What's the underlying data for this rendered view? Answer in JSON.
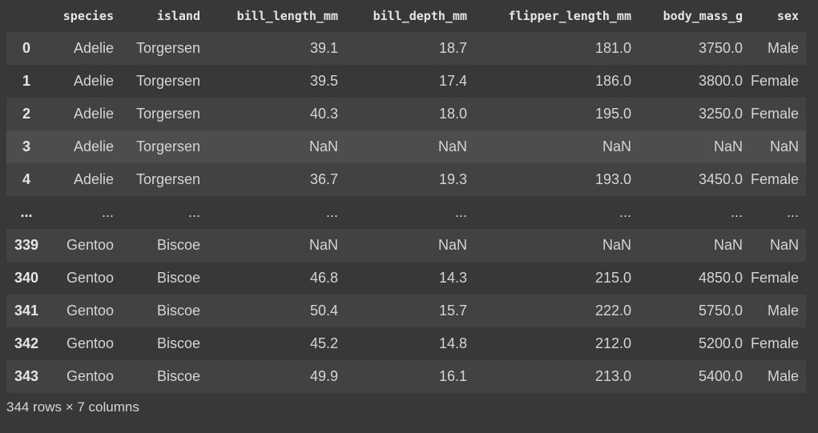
{
  "columns": [
    "species",
    "island",
    "bill_length_mm",
    "bill_depth_mm",
    "flipper_length_mm",
    "body_mass_g",
    "sex"
  ],
  "rows": [
    {
      "index": "0",
      "cells": [
        "Adelie",
        "Torgersen",
        "39.1",
        "18.7",
        "181.0",
        "3750.0",
        "Male"
      ]
    },
    {
      "index": "1",
      "cells": [
        "Adelie",
        "Torgersen",
        "39.5",
        "17.4",
        "186.0",
        "3800.0",
        "Female"
      ]
    },
    {
      "index": "2",
      "cells": [
        "Adelie",
        "Torgersen",
        "40.3",
        "18.0",
        "195.0",
        "3250.0",
        "Female"
      ]
    },
    {
      "index": "3",
      "cells": [
        "Adelie",
        "Torgersen",
        "NaN",
        "NaN",
        "NaN",
        "NaN",
        "NaN"
      ]
    },
    {
      "index": "4",
      "cells": [
        "Adelie",
        "Torgersen",
        "36.7",
        "19.3",
        "193.0",
        "3450.0",
        "Female"
      ]
    },
    {
      "index": "...",
      "cells": [
        "...",
        "...",
        "...",
        "...",
        "...",
        "...",
        "..."
      ]
    },
    {
      "index": "339",
      "cells": [
        "Gentoo",
        "Biscoe",
        "NaN",
        "NaN",
        "NaN",
        "NaN",
        "NaN"
      ]
    },
    {
      "index": "340",
      "cells": [
        "Gentoo",
        "Biscoe",
        "46.8",
        "14.3",
        "215.0",
        "4850.0",
        "Female"
      ]
    },
    {
      "index": "341",
      "cells": [
        "Gentoo",
        "Biscoe",
        "50.4",
        "15.7",
        "222.0",
        "5750.0",
        "Male"
      ]
    },
    {
      "index": "342",
      "cells": [
        "Gentoo",
        "Biscoe",
        "45.2",
        "14.8",
        "212.0",
        "5200.0",
        "Female"
      ]
    },
    {
      "index": "343",
      "cells": [
        "Gentoo",
        "Biscoe",
        "49.9",
        "16.1",
        "213.0",
        "5400.0",
        "Male"
      ]
    }
  ],
  "highlighted_row_index": "3",
  "footer": "344 rows × 7 columns",
  "colors": {
    "background": "#383838",
    "row_stripe": "#424242",
    "row_hover": "#4d4d4d",
    "text": "#d5d5d5"
  }
}
